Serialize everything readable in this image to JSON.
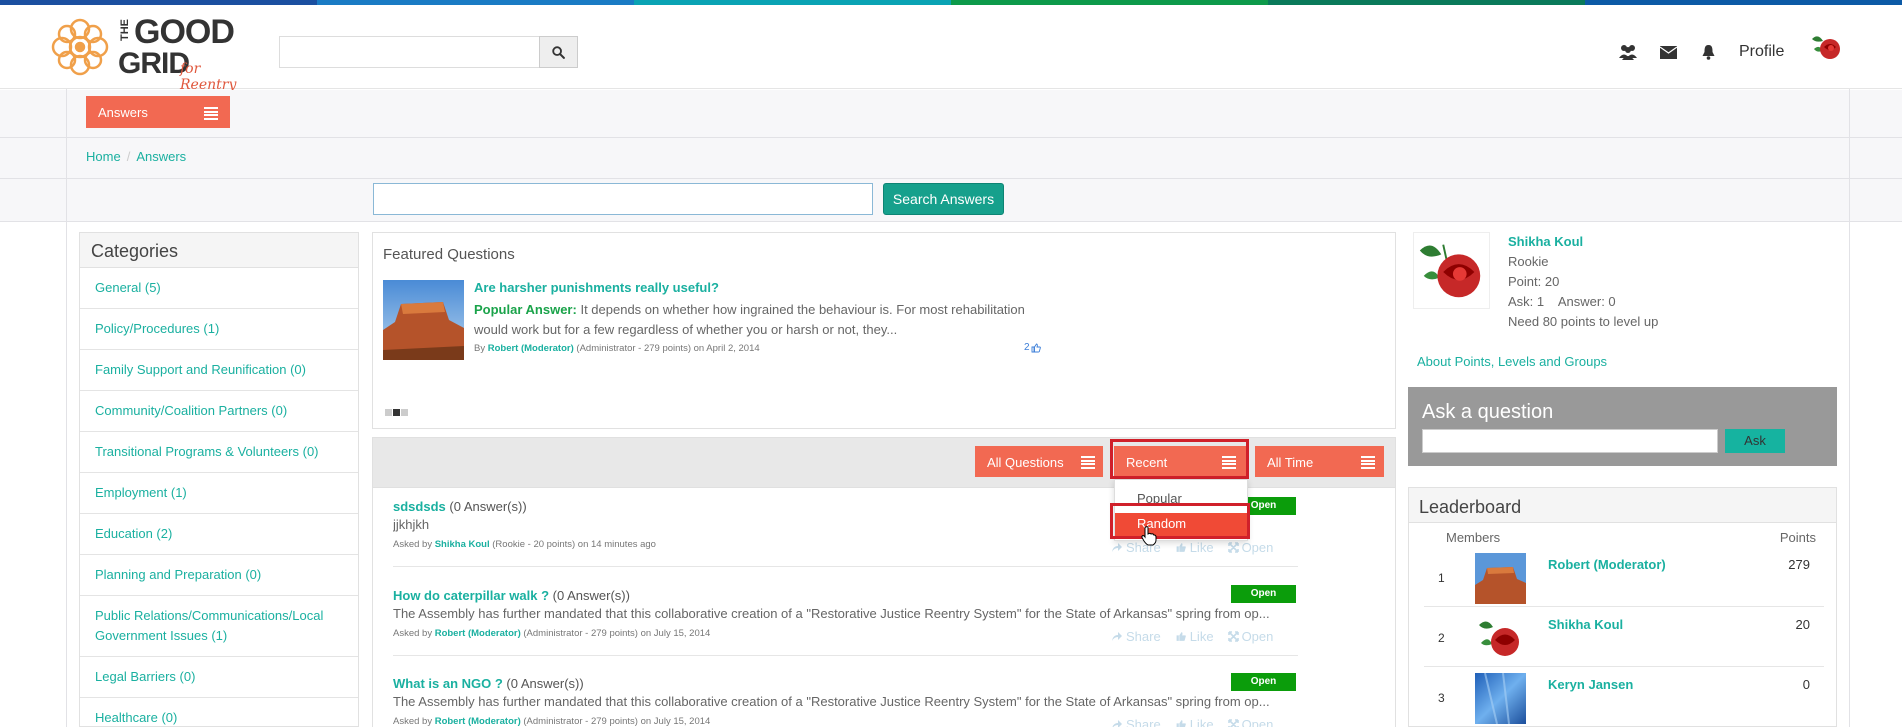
{
  "brand": {
    "top_colors": [
      "#1b4fa0",
      "#1a7bc4",
      "#0aa3b4",
      "#0d9a4a",
      "#0a7a5a",
      "#0c5aa6"
    ],
    "accent": "#f26952",
    "teal": "#1ab0a0",
    "logo_the": "THE",
    "logo_good": "GOOD",
    "logo_grid": "GRID",
    "logo_tagline": "for Reentry"
  },
  "header": {
    "search_value": "",
    "profile_label": "Profile",
    "icons": [
      "users-icon",
      "envelope-icon",
      "bell-icon"
    ]
  },
  "nav": {
    "answers_label": "Answers",
    "breadcrumb": [
      "Home",
      "Answers"
    ]
  },
  "main_search": {
    "value": "",
    "button_label": "Search Answers"
  },
  "categories": {
    "title": "Categories",
    "items": [
      "General (5)",
      "Policy/Procedures (1)",
      "Family Support and Reunification (0)",
      "Community/Coalition Partners (0)",
      "Transitional Programs & Volunteers (0)",
      "Employment (1)",
      "Education (2)",
      "Planning and Preparation (0)",
      "Public Relations/Communications/Local Government Issues (1)",
      "Legal Barriers (0)",
      "Healthcare (0)"
    ]
  },
  "featured": {
    "title": "Featured Questions",
    "question": "Are harsher punishments really useful?",
    "popular_label": "Popular Answer:",
    "answer": "It depends on whether how ingrained the behaviour is. For most rehabilitation would work but for a few regardless of whether you or harsh or not, they...",
    "by_label": "By",
    "author": "Robert (Moderator)",
    "author_info": "(Administrator - 279 points)",
    "date": "on April 2, 2014",
    "likes": "2"
  },
  "filters": {
    "all_questions": "All Questions",
    "recent": "Recent",
    "all_time": "All Time",
    "dropdown": [
      "Popular",
      "Random"
    ],
    "dropdown_active": "Random"
  },
  "questions": [
    {
      "title": "sdsdsds",
      "answers": "(0 Answer(s))",
      "body": "jjkhjkh",
      "asked_by": "Asked by",
      "author": "Shikha Koul",
      "meta": "(Rookie - 20 points) on 14 minutes ago",
      "status": "Open"
    },
    {
      "title": "How do caterpillar walk ?",
      "answers": "(0 Answer(s))",
      "body": "The Assembly has further mandated that this collaborative creation of a \"Restorative Justice Reentry System\" for the State of Arkansas\" spring from op...",
      "asked_by": "Asked by",
      "author": "Robert (Moderator)",
      "meta": "(Administrator - 279 points) on July 15, 2014",
      "status": "Open"
    },
    {
      "title": "What is an NGO ?",
      "answers": "(0 Answer(s))",
      "body": "The Assembly has further mandated that this collaborative creation of a \"Restorative Justice Reentry System\" for the State of Arkansas\" spring from op...",
      "asked_by": "Asked by",
      "author": "Robert (Moderator)",
      "meta": "(Administrator - 279 points) on July 15, 2014",
      "status": "Open"
    }
  ],
  "actions": {
    "share": "Share",
    "like": "Like",
    "open": "Open"
  },
  "user": {
    "name": "Shikha Koul",
    "rank": "Rookie",
    "points": "Point: 20",
    "ask_answer": "Ask: 1    Answer: 0",
    "level_up": "Need 80 points to level up",
    "about_link": "About Points, Levels and Groups"
  },
  "ask": {
    "title": "Ask a question",
    "value": "",
    "button": "Ask"
  },
  "leaderboard": {
    "title": "Leaderboard",
    "col_members": "Members",
    "col_points": "Points",
    "rows": [
      {
        "rank": "1",
        "name": "Robert (Moderator)",
        "points": "279"
      },
      {
        "rank": "2",
        "name": "Shikha Koul",
        "points": "20"
      },
      {
        "rank": "3",
        "name": "Keryn Jansen",
        "points": "0"
      }
    ]
  }
}
